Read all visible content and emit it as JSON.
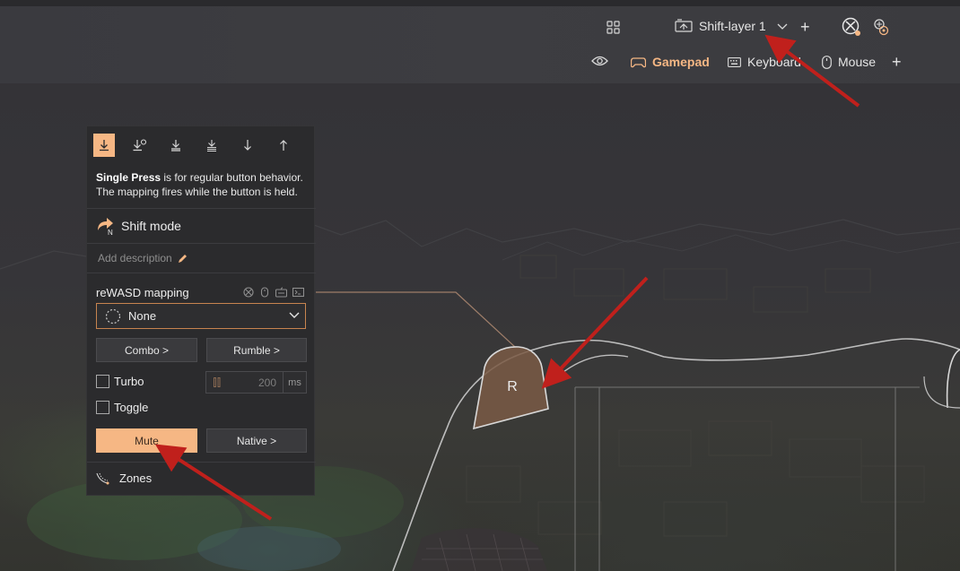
{
  "header": {
    "layer_name": "Shift-layer 1",
    "tabs": [
      {
        "label": "Gamepad",
        "icon": "gamepad-icon",
        "active": true
      },
      {
        "label": "Keyboard",
        "icon": "keyboard-icon",
        "active": false
      },
      {
        "label": "Mouse",
        "icon": "mouse-icon",
        "active": false
      }
    ]
  },
  "panel": {
    "press_description_bold": "Single Press",
    "press_description_rest": " is for regular button behavior. The mapping fires while the button is held.",
    "shift_mode_label": "Shift mode",
    "shift_mode_badge": "N",
    "add_description": "Add description",
    "mapping_label": "reWASD mapping",
    "mapping_value": "None",
    "combo_label": "Combo >",
    "rumble_label": "Rumble >",
    "turbo_label": "Turbo",
    "turbo_value": "200",
    "turbo_unit": "ms",
    "toggle_label": "Toggle",
    "mute_label": "Mute",
    "native_label": "Native >",
    "zones_label": "Zones"
  },
  "controller": {
    "button_label": "R"
  },
  "colors": {
    "accent": "#f6b784",
    "arrow": "#c0201c",
    "panel_bg": "#2b2b2d"
  }
}
